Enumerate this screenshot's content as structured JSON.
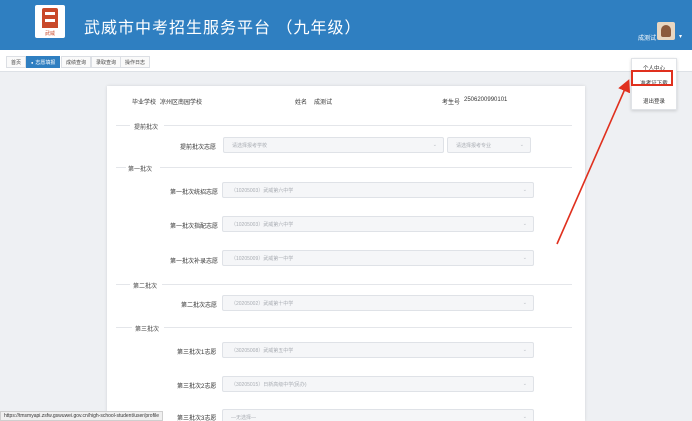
{
  "header": {
    "title": "武威市中考招生服务平台 （九年级）",
    "logo_text": "武威",
    "user_name": "成测试",
    "caret": "▾"
  },
  "tabs": [
    {
      "label": "首页",
      "active": false
    },
    {
      "label": "志愿填报",
      "active": true
    },
    {
      "label": "成绩查询",
      "active": false
    },
    {
      "label": "录取查询",
      "active": false
    },
    {
      "label": "操作日志",
      "active": false
    }
  ],
  "student": {
    "school_label": "毕业学校",
    "school_value": "凉州区南园学校",
    "name_label": "姓名",
    "name_value": "成测试",
    "exam_no_label": "考生号",
    "exam_no_value": "2506200990101"
  },
  "sections": {
    "early": "提前批次",
    "first": "第一批次",
    "second": "第二批次",
    "third": "第三批次"
  },
  "fields": {
    "early_label": "提前批次志愿",
    "early_school_placeholder": "请选择报考学校",
    "early_major_placeholder": "请选择报考专业",
    "first_unified_label": "第一批次统招志愿",
    "first_unified_value": "（10205003）武威第六中学",
    "first_allocated_label": "第一批次指配志愿",
    "first_allocated_value": "（10205003）武威第六中学",
    "first_supplement_label": "第一批次补录志愿",
    "first_supplement_value": "（10205009）武威第一中学",
    "second_label": "第二批次志愿",
    "second_value": "（20205002）武威第十中学",
    "third1_label": "第三批次1志愿",
    "third1_value": "（30205008）武威第五中学",
    "third2_label": "第三批次2志愿",
    "third2_value": "（30205015）日新高级中学(民办)",
    "third3_label": "第三批次3志愿",
    "third3_value": "—无选择—"
  },
  "user_menu": {
    "items": [
      "个人中心",
      "准考证下载",
      "退出登录"
    ]
  },
  "status_url": "https://tmsmyapi.zsfw.gswuwei.gov.cn/high-school-student/user/profile",
  "colors": {
    "header_bg": "#2f7fc1",
    "highlight": "#e0301e",
    "arrow": "#e0301e"
  },
  "icons": {
    "dropdown": "chevron-down-icon",
    "user_caret": "caret-down-icon"
  }
}
